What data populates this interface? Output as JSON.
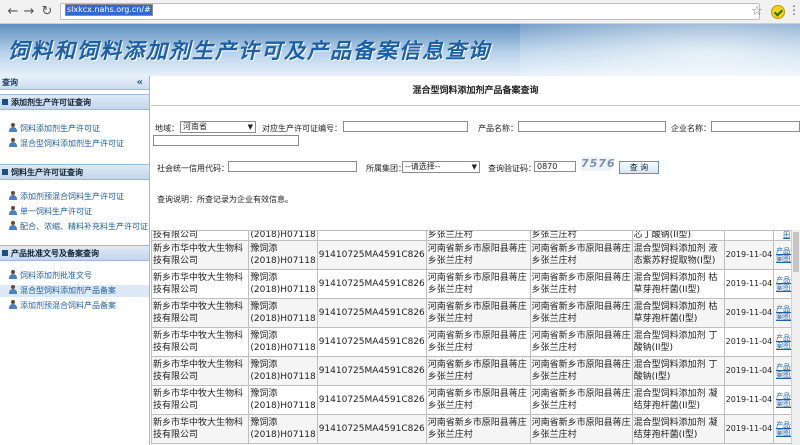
{
  "browser": {
    "url_host": "slxkcx.nahs.org.cn",
    "url_hash": "/#"
  },
  "banner": {
    "title": "饲料和饲料添加剂生产许可及产品备案信息查询"
  },
  "sidebar": {
    "header": "查询",
    "collapse": "«",
    "groups": [
      {
        "title": "添加剂生产许可证查询",
        "items": [
          {
            "label": "饲料添加剂生产许可证"
          },
          {
            "label": "混合型饲料添加剂生产许可证"
          }
        ]
      },
      {
        "title": "饲料生产许可证查询",
        "items": [
          {
            "label": "添加剂预混合饲料生产许可证"
          },
          {
            "label": "单一饲料生产许可证"
          },
          {
            "label": "配合、浓缩、精料补充料生产许可证"
          }
        ]
      },
      {
        "title": "产品批准文号及备案查询",
        "items": [
          {
            "label": "饲料添加剂批准文号"
          },
          {
            "label": "混合型饲料添加剂产品备案"
          },
          {
            "label": "添加剂预混合饲料产品备案"
          }
        ]
      }
    ]
  },
  "main": {
    "title": "混合型饲料添加剂产品备案查询",
    "form": {
      "region_label": "地域：",
      "region_value": "河南省",
      "license_label": "对应生产许可证编号：",
      "product_label": "产品名称：",
      "company_label": "企业名称：",
      "credit_label": "社会统一信用代码：",
      "group_label": "所属集团：",
      "group_value": "--请选择--",
      "captcha_label": "查询验证码：",
      "captcha_value": "0870",
      "captcha_image": "7576",
      "query_button": "查 询",
      "note": "查询说明：所查记录为企业有效信息。"
    },
    "table": {
      "partial_row": [
        "技有限公司",
        "(2018)H07118",
        "",
        "乡张兰庄村",
        "乡张兰庄村",
        "芯丁酸钠(II型)",
        "",
        "田"
      ],
      "rows": [
        [
          "新乡市华中牧大生物科技有限公司",
          "豫饲添(2018)H07118",
          "91410725MA4591C826",
          "河南省新乡市原阳县蒋庄乡张兰庄村",
          "河南省新乡市原阳县蒋庄乡张兰庄村",
          "混合型饲料添加剂 液态紫苏籽提取物(I型)",
          "2019-11-04",
          "产品备案图片"
        ],
        [
          "新乡市华中牧大生物科技有限公司",
          "豫饲添(2018)H07118",
          "91410725MA4591C826",
          "河南省新乡市原阳县蒋庄乡张兰庄村",
          "河南省新乡市原阳县蒋庄乡张兰庄村",
          "混合型饲料添加剂 枯草芽孢杆菌(II型)",
          "2019-11-04",
          "产品备案图片"
        ],
        [
          "新乡市华中牧大生物科技有限公司",
          "豫饲添(2018)H07118",
          "91410725MA4591C826",
          "河南省新乡市原阳县蒋庄乡张兰庄村",
          "河南省新乡市原阳县蒋庄乡张兰庄村",
          "混合型饲料添加剂 枯草芽孢杆菌(I型)",
          "2019-11-04",
          "产品备案图片"
        ],
        [
          "新乡市华中牧大生物科技有限公司",
          "豫饲添(2018)H07118",
          "91410725MA4591C826",
          "河南省新乡市原阳县蒋庄乡张兰庄村",
          "河南省新乡市原阳县蒋庄乡张兰庄村",
          "混合型饲料添加剂 丁酸钠(II型)",
          "2019-11-04",
          "产品备案图片"
        ],
        [
          "新乡市华中牧大生物科技有限公司",
          "豫饲添(2018)H07118",
          "91410725MA4591C826",
          "河南省新乡市原阳县蒋庄乡张兰庄村",
          "河南省新乡市原阳县蒋庄乡张兰庄村",
          "混合型饲料添加剂 丁酸钠(I型)",
          "2019-11-04",
          "产品备案图片"
        ],
        [
          "新乡市华中牧大生物科技有限公司",
          "豫饲添(2018)H07118",
          "91410725MA4591C826",
          "河南省新乡市原阳县蒋庄乡张兰庄村",
          "河南省新乡市原阳县蒋庄乡张兰庄村",
          "混合型饲料添加剂 凝结芽孢杆菌(II型)",
          "2019-11-04",
          "产品备案图片"
        ],
        [
          "新乡市华中牧大生物科技有限公司",
          "豫饲添(2018)H07118",
          "91410725MA4591C826",
          "河南省新乡市原阳县蒋庄乡张兰庄村",
          "河南省新乡市原阳县蒋庄乡张兰庄村",
          "混合型饲料添加剂 凝结芽孢杆菌(I型)",
          "2019-11-04",
          "产品备案图片"
        ]
      ]
    }
  }
}
